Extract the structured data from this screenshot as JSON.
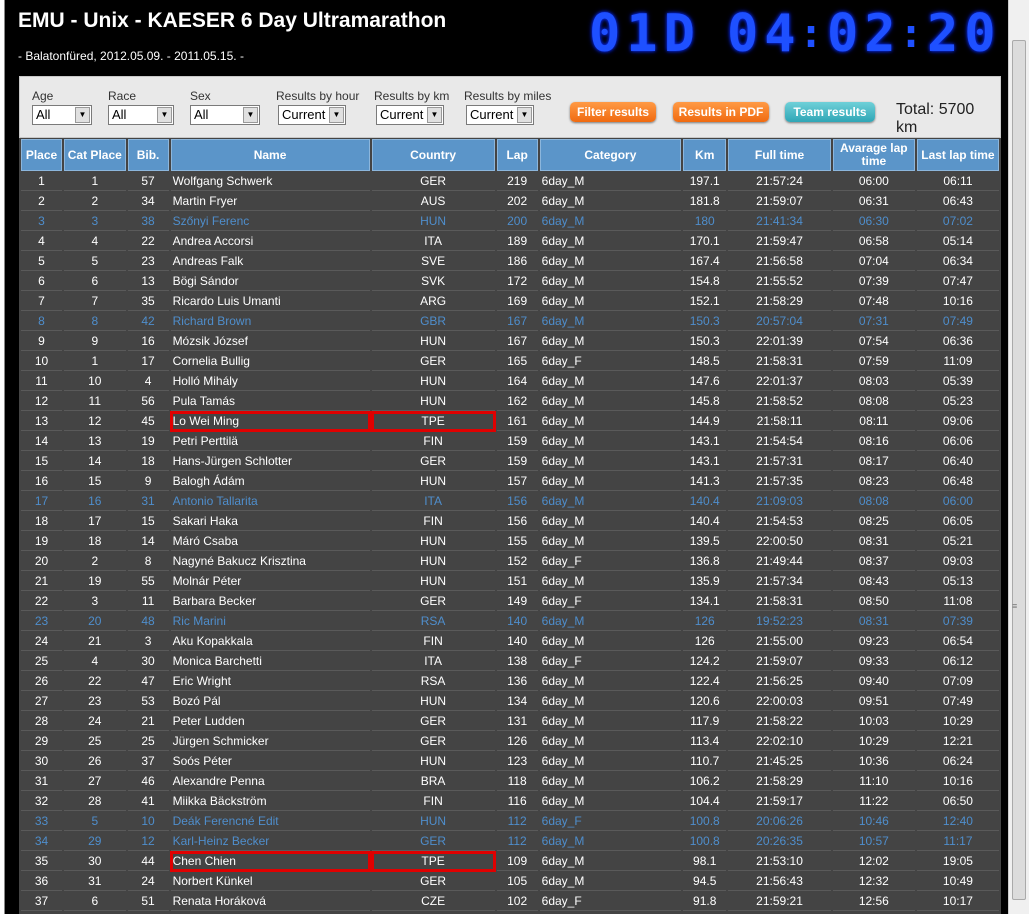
{
  "header": {
    "title": "EMU - Unix - KAESER 6 Day Ultramarathon",
    "subtitle": "- Balatonfüred, 2012.05.09. - 2011.05.15. -",
    "clock_days": "01D",
    "clock_hours": "04",
    "clock_minutes": "02",
    "clock_seconds": "20"
  },
  "filters": {
    "age_label": "Age",
    "age_value": "All",
    "race_label": "Race",
    "race_value": "All",
    "sex_label": "Sex",
    "sex_value": "All",
    "hour_label": "Results by hour",
    "hour_value": "Current",
    "km_label": "Results by km",
    "km_value": "Current",
    "miles_label": "Results by miles",
    "miles_value": "Current",
    "filter_button": "Filter results",
    "pdf_button": "Results in PDF",
    "team_button": "Team results",
    "total": "Total: 5700 km"
  },
  "colors": {
    "accent_blue": "#5b95c9",
    "highlight_text": "#4f8ecc",
    "clock_blue": "#1e50ff",
    "box_red": "#e00000"
  },
  "table": {
    "columns": [
      "Place",
      "Cat Place",
      "Bib.",
      "Name",
      "Country",
      "Lap",
      "Category",
      "Km",
      "Full time",
      "Avarage lap time",
      "Last lap time"
    ],
    "rows": [
      {
        "place": "1",
        "cat": "1",
        "bib": "57",
        "name": "Wolfgang Schwerk",
        "country": "GER",
        "lap": "219",
        "category": "6day_M",
        "km": "197.1",
        "full": "21:57:24",
        "avg": "06:00",
        "last": "06:11"
      },
      {
        "place": "2",
        "cat": "2",
        "bib": "34",
        "name": "Martin Fryer",
        "country": "AUS",
        "lap": "202",
        "category": "6day_M",
        "km": "181.8",
        "full": "21:59:07",
        "avg": "06:31",
        "last": "06:43"
      },
      {
        "place": "3",
        "cat": "3",
        "bib": "38",
        "name": "Szőnyi Ferenc",
        "country": "HUN",
        "lap": "200",
        "category": "6day_M",
        "km": "180",
        "full": "21:41:34",
        "avg": "06:30",
        "last": "07:02",
        "hl": true
      },
      {
        "place": "4",
        "cat": "4",
        "bib": "22",
        "name": "Andrea Accorsi",
        "country": "ITA",
        "lap": "189",
        "category": "6day_M",
        "km": "170.1",
        "full": "21:59:47",
        "avg": "06:58",
        "last": "05:14"
      },
      {
        "place": "5",
        "cat": "5",
        "bib": "23",
        "name": "Andreas Falk",
        "country": "SVE",
        "lap": "186",
        "category": "6day_M",
        "km": "167.4",
        "full": "21:56:58",
        "avg": "07:04",
        "last": "06:34"
      },
      {
        "place": "6",
        "cat": "6",
        "bib": "13",
        "name": "Bögi Sándor",
        "country": "SVK",
        "lap": "172",
        "category": "6day_M",
        "km": "154.8",
        "full": "21:55:52",
        "avg": "07:39",
        "last": "07:47"
      },
      {
        "place": "7",
        "cat": "7",
        "bib": "35",
        "name": "Ricardo Luis Umanti",
        "country": "ARG",
        "lap": "169",
        "category": "6day_M",
        "km": "152.1",
        "full": "21:58:29",
        "avg": "07:48",
        "last": "10:16"
      },
      {
        "place": "8",
        "cat": "8",
        "bib": "42",
        "name": "Richard Brown",
        "country": "GBR",
        "lap": "167",
        "category": "6day_M",
        "km": "150.3",
        "full": "20:57:04",
        "avg": "07:31",
        "last": "07:49",
        "hl": true
      },
      {
        "place": "9",
        "cat": "9",
        "bib": "16",
        "name": "Mózsik József",
        "country": "HUN",
        "lap": "167",
        "category": "6day_M",
        "km": "150.3",
        "full": "22:01:39",
        "avg": "07:54",
        "last": "06:36"
      },
      {
        "place": "10",
        "cat": "1",
        "bib": "17",
        "name": "Cornelia Bullig",
        "country": "GER",
        "lap": "165",
        "category": "6day_F",
        "km": "148.5",
        "full": "21:58:31",
        "avg": "07:59",
        "last": "11:09"
      },
      {
        "place": "11",
        "cat": "10",
        "bib": "4",
        "name": "Holló Mihály",
        "country": "HUN",
        "lap": "164",
        "category": "6day_M",
        "km": "147.6",
        "full": "22:01:37",
        "avg": "08:03",
        "last": "05:39"
      },
      {
        "place": "12",
        "cat": "11",
        "bib": "56",
        "name": "Pula Tamás",
        "country": "HUN",
        "lap": "162",
        "category": "6day_M",
        "km": "145.8",
        "full": "21:58:52",
        "avg": "08:08",
        "last": "05:23"
      },
      {
        "place": "13",
        "cat": "12",
        "bib": "45",
        "name": "Lo Wei Ming",
        "country": "TPE",
        "lap": "161",
        "category": "6day_M",
        "km": "144.9",
        "full": "21:58:11",
        "avg": "08:11",
        "last": "09:06",
        "box": true
      },
      {
        "place": "14",
        "cat": "13",
        "bib": "19",
        "name": "Petri Perttilä",
        "country": "FIN",
        "lap": "159",
        "category": "6day_M",
        "km": "143.1",
        "full": "21:54:54",
        "avg": "08:16",
        "last": "06:06"
      },
      {
        "place": "15",
        "cat": "14",
        "bib": "18",
        "name": "Hans-Jürgen Schlotter",
        "country": "GER",
        "lap": "159",
        "category": "6day_M",
        "km": "143.1",
        "full": "21:57:31",
        "avg": "08:17",
        "last": "06:40"
      },
      {
        "place": "16",
        "cat": "15",
        "bib": "9",
        "name": "Balogh Ádám",
        "country": "HUN",
        "lap": "157",
        "category": "6day_M",
        "km": "141.3",
        "full": "21:57:35",
        "avg": "08:23",
        "last": "06:48"
      },
      {
        "place": "17",
        "cat": "16",
        "bib": "31",
        "name": "Antonio Tallarita",
        "country": "ITA",
        "lap": "156",
        "category": "6day_M",
        "km": "140.4",
        "full": "21:09:03",
        "avg": "08:08",
        "last": "06:00",
        "hl": true
      },
      {
        "place": "18",
        "cat": "17",
        "bib": "15",
        "name": "Sakari Haka",
        "country": "FIN",
        "lap": "156",
        "category": "6day_M",
        "km": "140.4",
        "full": "21:54:53",
        "avg": "08:25",
        "last": "06:05"
      },
      {
        "place": "19",
        "cat": "18",
        "bib": "14",
        "name": "Máró Csaba",
        "country": "HUN",
        "lap": "155",
        "category": "6day_M",
        "km": "139.5",
        "full": "22:00:50",
        "avg": "08:31",
        "last": "05:21"
      },
      {
        "place": "20",
        "cat": "2",
        "bib": "8",
        "name": "Nagyné Bakucz Krisztina",
        "country": "HUN",
        "lap": "152",
        "category": "6day_F",
        "km": "136.8",
        "full": "21:49:44",
        "avg": "08:37",
        "last": "09:03"
      },
      {
        "place": "21",
        "cat": "19",
        "bib": "55",
        "name": "Molnár Péter",
        "country": "HUN",
        "lap": "151",
        "category": "6day_M",
        "km": "135.9",
        "full": "21:57:34",
        "avg": "08:43",
        "last": "05:13"
      },
      {
        "place": "22",
        "cat": "3",
        "bib": "11",
        "name": "Barbara Becker",
        "country": "GER",
        "lap": "149",
        "category": "6day_F",
        "km": "134.1",
        "full": "21:58:31",
        "avg": "08:50",
        "last": "11:08"
      },
      {
        "place": "23",
        "cat": "20",
        "bib": "48",
        "name": "Ric Marini",
        "country": "RSA",
        "lap": "140",
        "category": "6day_M",
        "km": "126",
        "full": "19:52:23",
        "avg": "08:31",
        "last": "07:39",
        "hl": true
      },
      {
        "place": "24",
        "cat": "21",
        "bib": "3",
        "name": "Aku Kopakkala",
        "country": "FIN",
        "lap": "140",
        "category": "6day_M",
        "km": "126",
        "full": "21:55:00",
        "avg": "09:23",
        "last": "06:54"
      },
      {
        "place": "25",
        "cat": "4",
        "bib": "30",
        "name": "Monica Barchetti",
        "country": "ITA",
        "lap": "138",
        "category": "6day_F",
        "km": "124.2",
        "full": "21:59:07",
        "avg": "09:33",
        "last": "06:12"
      },
      {
        "place": "26",
        "cat": "22",
        "bib": "47",
        "name": "Eric Wright",
        "country": "RSA",
        "lap": "136",
        "category": "6day_M",
        "km": "122.4",
        "full": "21:56:25",
        "avg": "09:40",
        "last": "07:09"
      },
      {
        "place": "27",
        "cat": "23",
        "bib": "53",
        "name": "Bozó Pál",
        "country": "HUN",
        "lap": "134",
        "category": "6day_M",
        "km": "120.6",
        "full": "22:00:03",
        "avg": "09:51",
        "last": "07:49"
      },
      {
        "place": "28",
        "cat": "24",
        "bib": "21",
        "name": "Peter Ludden",
        "country": "GER",
        "lap": "131",
        "category": "6day_M",
        "km": "117.9",
        "full": "21:58:22",
        "avg": "10:03",
        "last": "10:29"
      },
      {
        "place": "29",
        "cat": "25",
        "bib": "25",
        "name": "Jürgen Schmicker",
        "country": "GER",
        "lap": "126",
        "category": "6day_M",
        "km": "113.4",
        "full": "22:02:10",
        "avg": "10:29",
        "last": "12:21"
      },
      {
        "place": "30",
        "cat": "26",
        "bib": "37",
        "name": "Soós Péter",
        "country": "HUN",
        "lap": "123",
        "category": "6day_M",
        "km": "110.7",
        "full": "21:45:25",
        "avg": "10:36",
        "last": "06:24"
      },
      {
        "place": "31",
        "cat": "27",
        "bib": "46",
        "name": "Alexandre Penna",
        "country": "BRA",
        "lap": "118",
        "category": "6day_M",
        "km": "106.2",
        "full": "21:58:29",
        "avg": "11:10",
        "last": "10:16"
      },
      {
        "place": "32",
        "cat": "28",
        "bib": "41",
        "name": "Miikka Bäckström",
        "country": "FIN",
        "lap": "116",
        "category": "6day_M",
        "km": "104.4",
        "full": "21:59:17",
        "avg": "11:22",
        "last": "06:50"
      },
      {
        "place": "33",
        "cat": "5",
        "bib": "10",
        "name": "Deák Ferencné Edit",
        "country": "HUN",
        "lap": "112",
        "category": "6day_F",
        "km": "100.8",
        "full": "20:06:26",
        "avg": "10:46",
        "last": "12:40",
        "hl": true
      },
      {
        "place": "34",
        "cat": "29",
        "bib": "12",
        "name": "Karl-Heinz Becker",
        "country": "GER",
        "lap": "112",
        "category": "6day_M",
        "km": "100.8",
        "full": "20:26:35",
        "avg": "10:57",
        "last": "11:17",
        "hl": true
      },
      {
        "place": "35",
        "cat": "30",
        "bib": "44",
        "name": "Chen Chien",
        "country": "TPE",
        "lap": "109",
        "category": "6day_M",
        "km": "98.1",
        "full": "21:53:10",
        "avg": "12:02",
        "last": "19:05",
        "box": true
      },
      {
        "place": "36",
        "cat": "31",
        "bib": "24",
        "name": "Norbert Künkel",
        "country": "GER",
        "lap": "105",
        "category": "6day_M",
        "km": "94.5",
        "full": "21:56:43",
        "avg": "12:32",
        "last": "10:49"
      },
      {
        "place": "37",
        "cat": "6",
        "bib": "51",
        "name": "Renata Horáková",
        "country": "CZE",
        "lap": "102",
        "category": "6day_F",
        "km": "91.8",
        "full": "21:59:21",
        "avg": "12:56",
        "last": "10:17"
      }
    ]
  }
}
